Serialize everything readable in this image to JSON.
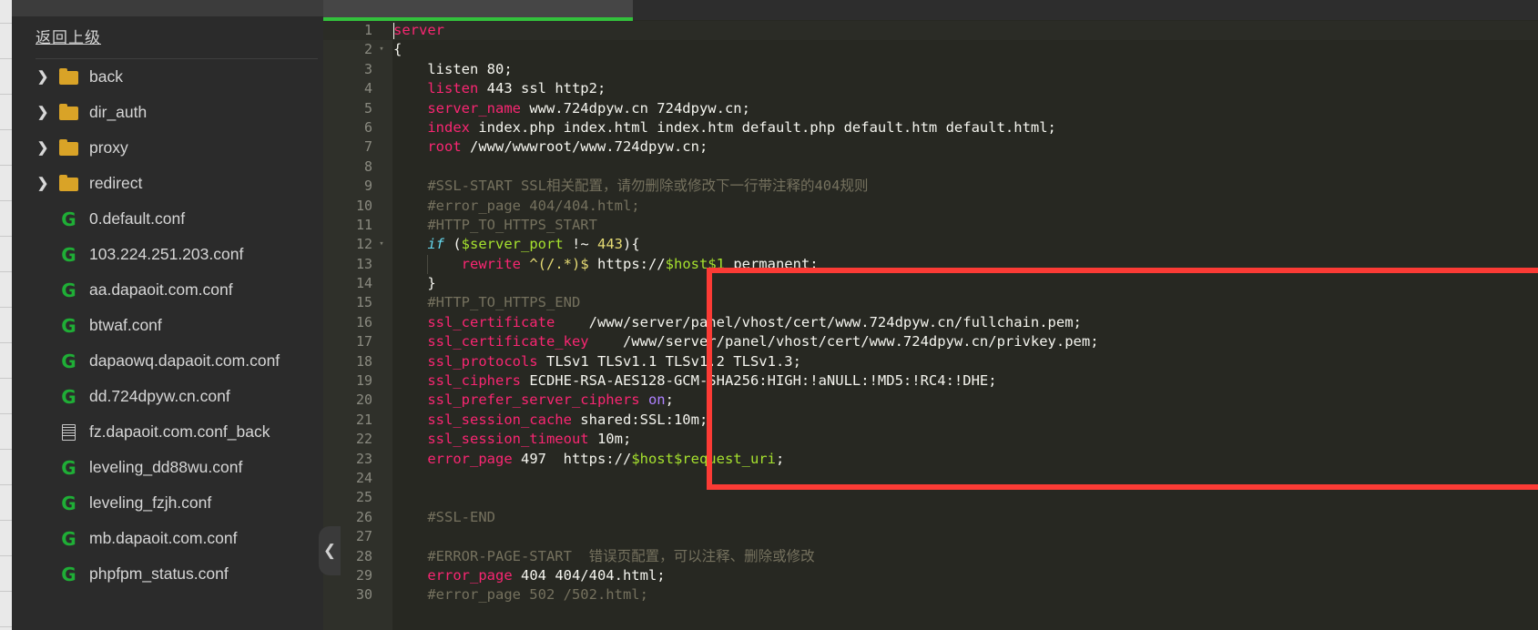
{
  "file_tree": {
    "back_label": "返回上级",
    "items": [
      {
        "name": "back",
        "icon": "folder-icon",
        "expandable": true
      },
      {
        "name": "dir_auth",
        "icon": "folder-icon",
        "expandable": true
      },
      {
        "name": "proxy",
        "icon": "folder-icon",
        "expandable": true
      },
      {
        "name": "redirect",
        "icon": "folder-icon",
        "expandable": true
      },
      {
        "name": "0.default.conf",
        "icon": "nginx-conf-icon",
        "expandable": false
      },
      {
        "name": "103.224.251.203.conf",
        "icon": "nginx-conf-icon",
        "expandable": false
      },
      {
        "name": "aa.dapaoit.com.conf",
        "icon": "nginx-conf-icon",
        "expandable": false
      },
      {
        "name": "btwaf.conf",
        "icon": "nginx-conf-icon",
        "expandable": false
      },
      {
        "name": "dapaowq.dapaoit.com.conf",
        "icon": "nginx-conf-icon",
        "expandable": false
      },
      {
        "name": "dd.724dpyw.cn.conf",
        "icon": "nginx-conf-icon",
        "expandable": false
      },
      {
        "name": "fz.dapaoit.com.conf_back",
        "icon": "text-file-icon",
        "expandable": false
      },
      {
        "name": "leveling_dd88wu.conf",
        "icon": "nginx-conf-icon",
        "expandable": false
      },
      {
        "name": "leveling_fzjh.conf",
        "icon": "nginx-conf-icon",
        "expandable": false
      },
      {
        "name": "mb.dapaoit.com.conf",
        "icon": "nginx-conf-icon",
        "expandable": false
      },
      {
        "name": "phpfpm_status.conf",
        "icon": "nginx-conf-icon",
        "expandable": false
      }
    ],
    "chevron_glyph": "❯",
    "collapse_glyph": "❮"
  },
  "editor": {
    "accent_color": "#33c13c",
    "background": "#272822",
    "annotation_box_color": "#fb3b35",
    "lines": [
      {
        "n": 1,
        "fold": "",
        "active": true,
        "caret": true,
        "tokens": [
          {
            "t": "server",
            "c": "t-key"
          }
        ]
      },
      {
        "n": 2,
        "fold": "▾",
        "tokens": [
          {
            "t": "{",
            "c": "t-txt"
          }
        ]
      },
      {
        "n": 3,
        "fold": "",
        "tokens": [
          {
            "t": "    listen 80;",
            "c": "t-txt"
          }
        ]
      },
      {
        "n": 4,
        "fold": "",
        "tokens": [
          {
            "t": "    ",
            "c": "t-txt"
          },
          {
            "t": "listen",
            "c": "t-key"
          },
          {
            "t": " 443 ssl http2;",
            "c": "t-txt"
          }
        ]
      },
      {
        "n": 5,
        "fold": "",
        "tokens": [
          {
            "t": "    ",
            "c": "t-txt"
          },
          {
            "t": "server_name",
            "c": "t-key"
          },
          {
            "t": " www.724dpyw.cn 724dpyw.cn;",
            "c": "t-txt"
          }
        ]
      },
      {
        "n": 6,
        "fold": "",
        "tokens": [
          {
            "t": "    ",
            "c": "t-txt"
          },
          {
            "t": "index",
            "c": "t-key"
          },
          {
            "t": " index.php index.html index.htm default.php default.htm default.html;",
            "c": "t-txt"
          }
        ]
      },
      {
        "n": 7,
        "fold": "",
        "tokens": [
          {
            "t": "    ",
            "c": "t-txt"
          },
          {
            "t": "root",
            "c": "t-key"
          },
          {
            "t": " /www/wwwroot/www.724dpyw.cn;",
            "c": "t-txt"
          }
        ]
      },
      {
        "n": 8,
        "fold": "",
        "tokens": []
      },
      {
        "n": 9,
        "fold": "",
        "tokens": [
          {
            "t": "    #SSL-START SSL相关配置，请勿删除或修改下一行带注释的404规则",
            "c": "t-com"
          }
        ]
      },
      {
        "n": 10,
        "fold": "",
        "tokens": [
          {
            "t": "    #error_page 404/404.html;",
            "c": "t-com"
          }
        ]
      },
      {
        "n": 11,
        "fold": "",
        "tokens": [
          {
            "t": "    #HTTP_TO_HTTPS_START",
            "c": "t-com"
          }
        ]
      },
      {
        "n": 12,
        "fold": "▾",
        "tokens": [
          {
            "t": "    ",
            "c": "t-txt"
          },
          {
            "t": "if",
            "c": "t-kw"
          },
          {
            "t": " (",
            "c": "t-txt"
          },
          {
            "t": "$server_port",
            "c": "t-var"
          },
          {
            "t": " !~ ",
            "c": "t-txt"
          },
          {
            "t": "443",
            "c": "t-num"
          },
          {
            "t": "){",
            "c": "t-txt"
          }
        ]
      },
      {
        "n": 13,
        "fold": "",
        "indent": 1,
        "tokens": [
          {
            "t": "        ",
            "c": "t-txt"
          },
          {
            "t": "rewrite",
            "c": "t-key"
          },
          {
            "t": " ",
            "c": "t-txt"
          },
          {
            "t": "^(/.*)$",
            "c": "t-num"
          },
          {
            "t": " https://",
            "c": "t-txt"
          },
          {
            "t": "$host$1",
            "c": "t-var"
          },
          {
            "t": " permanent;",
            "c": "t-txt"
          }
        ]
      },
      {
        "n": 14,
        "fold": "",
        "tokens": [
          {
            "t": "    }",
            "c": "t-txt"
          }
        ]
      },
      {
        "n": 15,
        "fold": "",
        "tokens": [
          {
            "t": "    #HTTP_TO_HTTPS_END",
            "c": "t-com"
          }
        ]
      },
      {
        "n": 16,
        "fold": "",
        "tokens": [
          {
            "t": "    ",
            "c": "t-txt"
          },
          {
            "t": "ssl_certificate",
            "c": "t-key"
          },
          {
            "t": "    /www/server/panel/vhost/cert/www.724dpyw.cn/fullchain.pem;",
            "c": "t-txt"
          }
        ]
      },
      {
        "n": 17,
        "fold": "",
        "tokens": [
          {
            "t": "    ",
            "c": "t-txt"
          },
          {
            "t": "ssl_certificate_key",
            "c": "t-key"
          },
          {
            "t": "    /www/server/panel/vhost/cert/www.724dpyw.cn/privkey.pem;",
            "c": "t-txt"
          }
        ]
      },
      {
        "n": 18,
        "fold": "",
        "tokens": [
          {
            "t": "    ",
            "c": "t-txt"
          },
          {
            "t": "ssl_protocols",
            "c": "t-key"
          },
          {
            "t": " TLSv1 TLSv1.1 TLSv1.2 TLSv1.3;",
            "c": "t-txt"
          }
        ]
      },
      {
        "n": 19,
        "fold": "",
        "tokens": [
          {
            "t": "    ",
            "c": "t-txt"
          },
          {
            "t": "ssl_ciphers",
            "c": "t-key"
          },
          {
            "t": " ECDHE-RSA-AES128-GCM-SHA256:HIGH:!aNULL:!MD5:!RC4:!DHE;",
            "c": "t-txt"
          }
        ]
      },
      {
        "n": 20,
        "fold": "",
        "tokens": [
          {
            "t": "    ",
            "c": "t-txt"
          },
          {
            "t": "ssl_prefer_server_ciphers",
            "c": "t-key"
          },
          {
            "t": " ",
            "c": "t-txt"
          },
          {
            "t": "on",
            "c": "t-const"
          },
          {
            "t": ";",
            "c": "t-txt"
          }
        ]
      },
      {
        "n": 21,
        "fold": "",
        "tokens": [
          {
            "t": "    ",
            "c": "t-txt"
          },
          {
            "t": "ssl_session_cache",
            "c": "t-key"
          },
          {
            "t": " shared:SSL:10m;",
            "c": "t-txt"
          }
        ]
      },
      {
        "n": 22,
        "fold": "",
        "tokens": [
          {
            "t": "    ",
            "c": "t-txt"
          },
          {
            "t": "ssl_session_timeout",
            "c": "t-key"
          },
          {
            "t": " 10m;",
            "c": "t-txt"
          }
        ]
      },
      {
        "n": 23,
        "fold": "",
        "tokens": [
          {
            "t": "    ",
            "c": "t-txt"
          },
          {
            "t": "error_page",
            "c": "t-key"
          },
          {
            "t": " 497  https://",
            "c": "t-txt"
          },
          {
            "t": "$host$request_uri",
            "c": "t-var"
          },
          {
            "t": ";",
            "c": "t-txt"
          }
        ]
      },
      {
        "n": 24,
        "fold": "",
        "tokens": []
      },
      {
        "n": 25,
        "fold": "",
        "tokens": []
      },
      {
        "n": 26,
        "fold": "",
        "tokens": [
          {
            "t": "    #SSL-END",
            "c": "t-com"
          }
        ]
      },
      {
        "n": 27,
        "fold": "",
        "tokens": []
      },
      {
        "n": 28,
        "fold": "",
        "tokens": [
          {
            "t": "    #ERROR-PAGE-START  错误页配置，可以注释、删除或修改",
            "c": "t-com"
          }
        ]
      },
      {
        "n": 29,
        "fold": "",
        "tokens": [
          {
            "t": "    ",
            "c": "t-txt"
          },
          {
            "t": "error_page",
            "c": "t-key"
          },
          {
            "t": " 404 404/404.html;",
            "c": "t-txt"
          }
        ]
      },
      {
        "n": 30,
        "fold": "",
        "tokens": [
          {
            "t": "    #error_page 502 /502.html;",
            "c": "t-com"
          }
        ]
      }
    ]
  }
}
